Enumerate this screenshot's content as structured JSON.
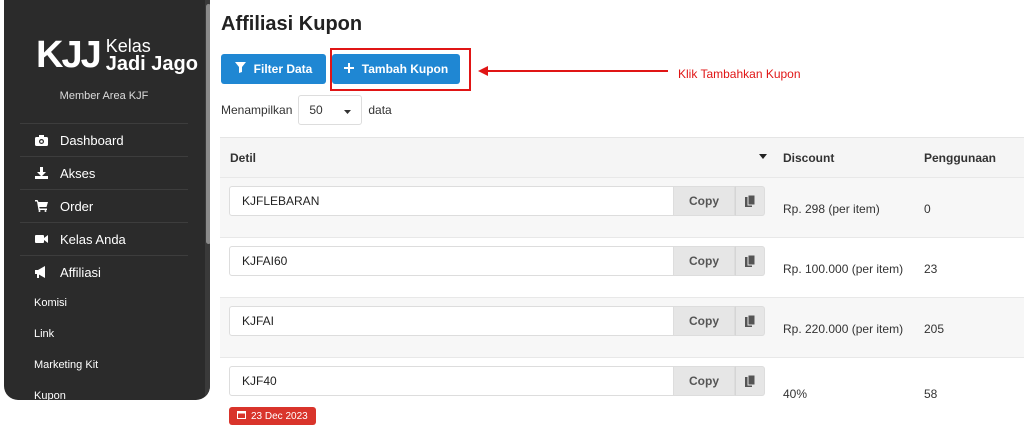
{
  "sidebar": {
    "logo_mark": "KJJ",
    "brand_line1": "Kelas",
    "brand_line2": "Jadi Jago",
    "member_area": "Member Area KJF",
    "items": [
      {
        "label": "Dashboard",
        "icon": "camera-icon"
      },
      {
        "label": "Akses",
        "icon": "download-icon"
      },
      {
        "label": "Order",
        "icon": "cart-icon"
      },
      {
        "label": "Kelas Anda",
        "icon": "video-icon"
      },
      {
        "label": "Affiliasi",
        "icon": "megaphone-icon"
      }
    ],
    "sub_items": [
      "Komisi",
      "Link",
      "Marketing Kit",
      "Kupon"
    ]
  },
  "page": {
    "title": "Affiliasi Kupon",
    "filter_button": "Filter Data",
    "add_button": "Tambah Kupon",
    "annotation": "Klik Tambahkan Kupon",
    "show_prefix": "Menampilkan",
    "show_value": "50",
    "show_suffix": "data"
  },
  "table": {
    "headers": {
      "detil": "Detil",
      "discount": "Discount",
      "usage": "Penggunaan"
    },
    "copy_label": "Copy",
    "rows": [
      {
        "code": "KJFLEBARAN",
        "discount": "Rp. 298 (per item)",
        "usage": "0"
      },
      {
        "code": "KJFAI60",
        "discount": "Rp. 100.000 (per item)",
        "usage": "23"
      },
      {
        "code": "KJFAI",
        "discount": "Rp. 220.000 (per item)",
        "usage": "205"
      },
      {
        "code": "KJF40",
        "discount": "40%",
        "usage": "58",
        "date": "23 Dec 2023"
      }
    ]
  },
  "colors": {
    "primary": "#1f87d3",
    "annotation": "#e01515",
    "sidebar": "#2b2b2b",
    "badge": "#d9342b"
  }
}
